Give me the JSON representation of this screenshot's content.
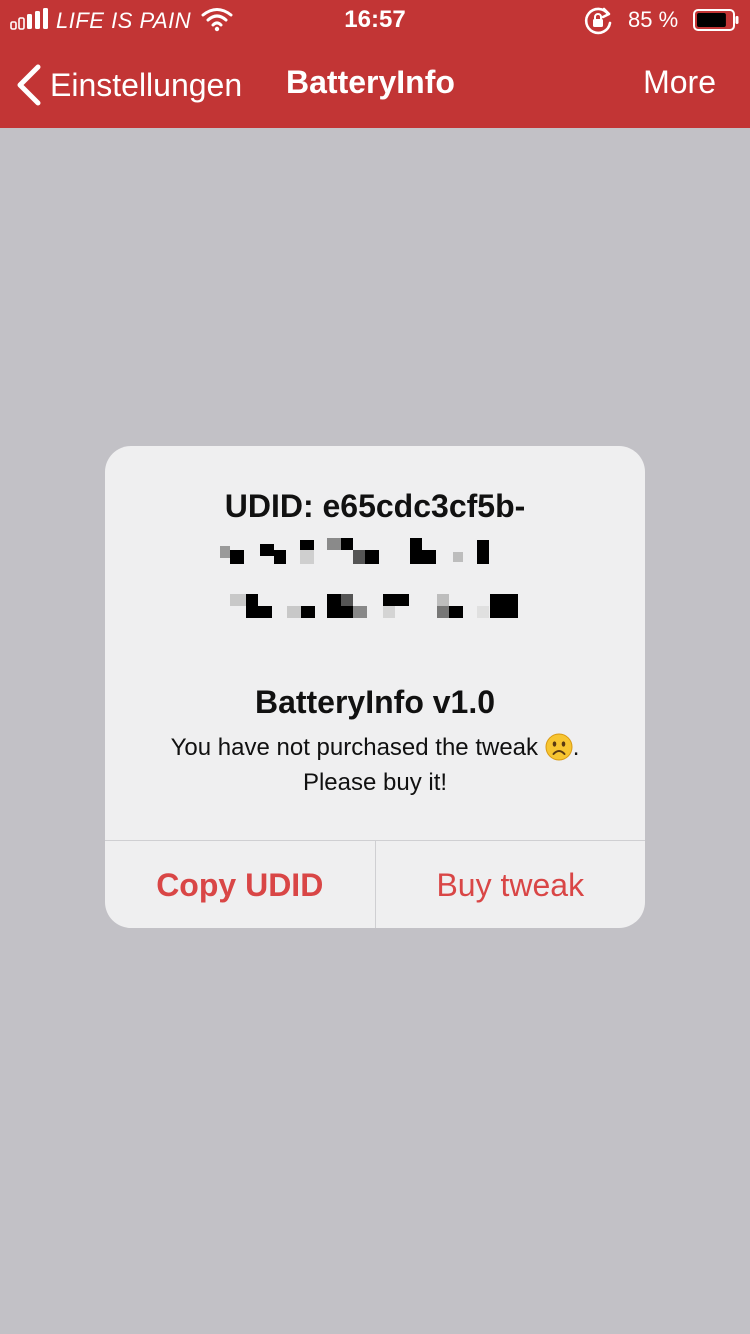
{
  "status_bar": {
    "carrier": "LIFE IS PAIN",
    "time": "16:57",
    "battery_percent": "85 %",
    "battery_level": 0.85,
    "icons": [
      "signal-icon",
      "wifi-icon",
      "rotation-lock-icon",
      "battery-icon"
    ]
  },
  "nav": {
    "back_label": "Einstellungen",
    "title": "BatteryInfo",
    "right_label": "More",
    "color": "#c23535"
  },
  "alert": {
    "udid_label": "UDID: e65cdc3cf5b-",
    "app_title": "BatteryInfo v1.0",
    "message_line1": "You have not purchased the tweak",
    "message_line1_end": ".",
    "message_line2": "Please buy it!",
    "emoji_icon": "sad-face-icon",
    "copy_button": "Copy UDID",
    "buy_button": "Buy tweak",
    "accent_color": "#d94646"
  }
}
